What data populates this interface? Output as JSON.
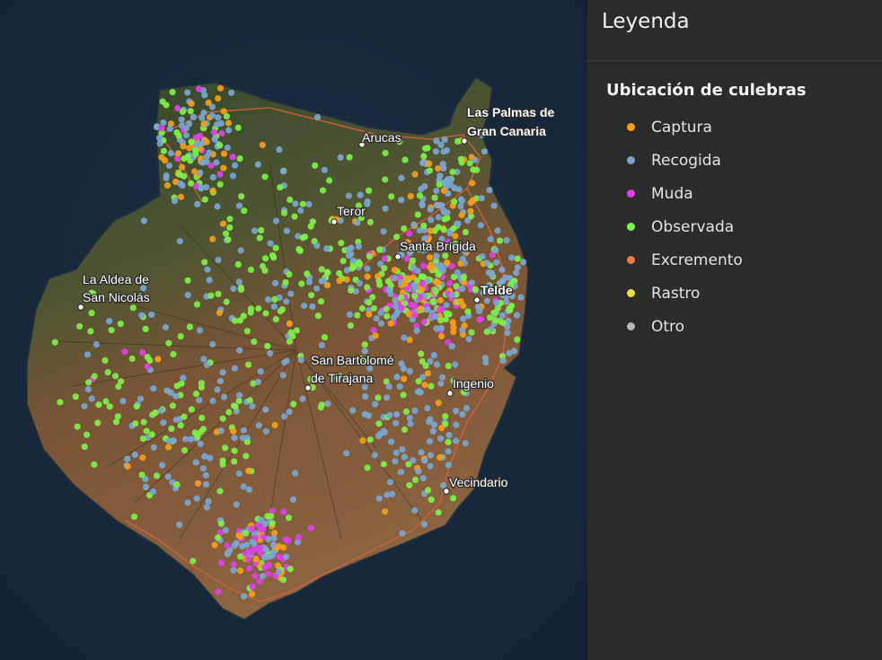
{
  "legend": {
    "title": "Leyenda",
    "layer_title": "Ubicación de culebras",
    "items": [
      {
        "key": "captura",
        "label": "Captura",
        "color": "#f59e1a"
      },
      {
        "key": "recogida",
        "label": "Recogida",
        "color": "#7aa6cf"
      },
      {
        "key": "muda",
        "label": "Muda",
        "color": "#e040e8"
      },
      {
        "key": "observada",
        "label": "Observada",
        "color": "#7ef04a"
      },
      {
        "key": "excremento",
        "label": "Excremento",
        "color": "#ee7a4a"
      },
      {
        "key": "rastro",
        "label": "Rastro",
        "color": "#f0e040"
      },
      {
        "key": "otro",
        "label": "Otro",
        "color": "#b8b8b8"
      }
    ]
  },
  "map": {
    "places": [
      {
        "key": "las-palmas",
        "name_line1": "Las Palmas de",
        "name_line2": "Gran Canaria",
        "bold": true
      },
      {
        "key": "arucas",
        "name_line1": "Arucas"
      },
      {
        "key": "teror",
        "name_line1": "Teror"
      },
      {
        "key": "santa-brigida",
        "name_line1": "Santa Brígida"
      },
      {
        "key": "la-aldea",
        "name_line1": "La Aldea de",
        "name_line2": "San Nicolás"
      },
      {
        "key": "telde",
        "name_line1": "Telde",
        "bold": true
      },
      {
        "key": "san-bartolome",
        "name_line1": "San Bartolomé",
        "name_line2": "de Tirajana"
      },
      {
        "key": "ingenio",
        "name_line1": "Ingenio"
      },
      {
        "key": "vecindario",
        "name_line1": "Vecindario"
      }
    ],
    "colors": {
      "ocean": "#1a2a3d",
      "terrain_north": "#35472a",
      "terrain_south": "#7a5535",
      "roads": "#d0613f"
    }
  }
}
